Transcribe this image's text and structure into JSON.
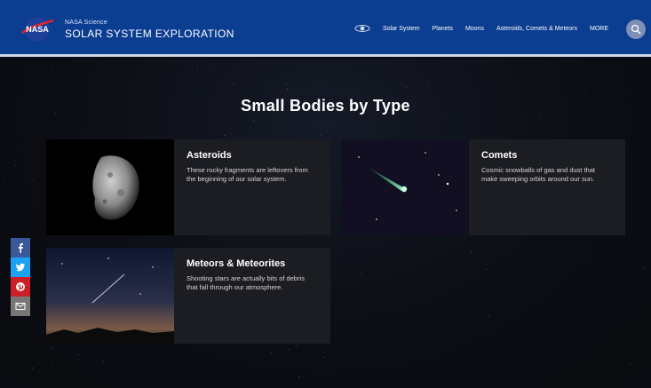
{
  "colors": {
    "header_bg": "#0b3d91",
    "facebook": "#3b5998",
    "twitter": "#1da1f2",
    "pinterest": "#cb2027",
    "email": "#777777"
  },
  "header": {
    "agency_label": "NASA Science",
    "site_title": "SOLAR SYSTEM EXPLORATION",
    "nav": [
      "Solar System",
      "Planets",
      "Moons",
      "Asteroids, Comets & Meteors",
      "MORE"
    ],
    "nav_icon": "orbit-icon",
    "search_icon": "search-icon"
  },
  "main": {
    "title": "Small Bodies by Type",
    "cards": [
      {
        "title": "Asteroids",
        "description": "These rocky fragments are leftovers from the beginning of our solar system.",
        "image_icon": "asteroid-image"
      },
      {
        "title": "Comets",
        "description": "Cosmic snowballs of gas and dust that make sweeping orbits around our sun.",
        "image_icon": "comet-image"
      },
      {
        "title": "Meteors & Meteorites",
        "description": "Shooting stars are actually bits of debris that fall through our atmosphere.",
        "image_icon": "meteor-image"
      }
    ]
  },
  "social": [
    "facebook-icon",
    "twitter-icon",
    "pinterest-icon",
    "email-icon"
  ]
}
